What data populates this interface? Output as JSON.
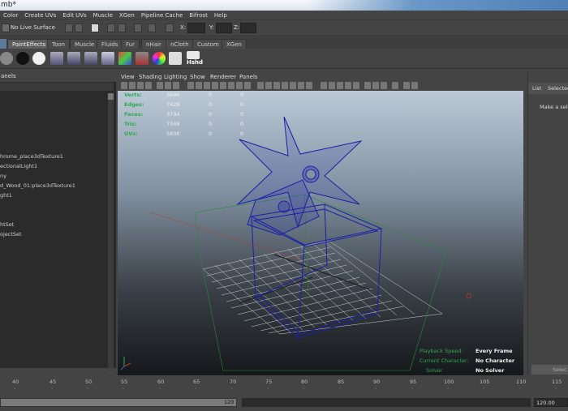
{
  "title": "mb*",
  "menus": [
    "Color",
    "Create UVs",
    "Edit UVs",
    "Muscle",
    "XGen",
    "Pipeline Cache",
    "Bifrost",
    "Help"
  ],
  "statusline": {
    "live_surface": "No Live Surface",
    "x_label": "X:",
    "y_label": "Y:",
    "z_label": "Z:"
  },
  "shelf_tabs": [
    "PaintEffects",
    "Toon",
    "Muscle",
    "Fluids",
    "Fur",
    "nHair",
    "nCloth",
    "Custom",
    "XGen"
  ],
  "shelf": {
    "hshd_label": "Hshd"
  },
  "outliner": {
    "header": "anels",
    "rows": [
      "hrome_place3dTexture1",
      "ectionalLight1",
      "ny",
      "d_Wood_01:place3dTexture1",
      "ght1",
      "htSet",
      "ojectSet"
    ]
  },
  "viewport": {
    "menus": [
      "View",
      "Shading",
      "Lighting",
      "Show",
      "Renderer",
      "Panels"
    ],
    "hud": {
      "rows": [
        {
          "label": "Verts:",
          "v1": "3686",
          "v2": "0",
          "v3": "0"
        },
        {
          "label": "Edges:",
          "v1": "7428",
          "v2": "0",
          "v3": "0"
        },
        {
          "label": "Faces:",
          "v1": "3734",
          "v2": "0",
          "v3": "0"
        },
        {
          "label": "Tris:",
          "v1": "7348",
          "v2": "0",
          "v3": "0"
        },
        {
          "label": "UVs:",
          "v1": "5830",
          "v2": "0",
          "v3": "0"
        }
      ],
      "playback_speed_label": "Playback Speed:",
      "playback_speed_value": "Every Frame",
      "current_character_label": "Current Character:",
      "current_character_value": "No Character",
      "solver_label": "Solver",
      "solver_value": "No Solver"
    }
  },
  "right_panel": {
    "tab_list": "List",
    "tab_selected": "Selected",
    "hint": "Make a selec",
    "select_button": "Selec"
  },
  "timeline": {
    "ticks": [
      "40",
      "45",
      "50",
      "55",
      "60",
      "65",
      "70",
      "75",
      "80",
      "85",
      "90",
      "95",
      "100",
      "105",
      "110",
      "115"
    ],
    "range_end": "120",
    "end_field": "120.00"
  },
  "colors": {
    "hud_green": "#2ea84e",
    "wire_blue": "#1a1fa8",
    "grid_green": "#2b8a3d",
    "viewport_top": "#bcc9d7",
    "viewport_bottom": "#15181b"
  }
}
